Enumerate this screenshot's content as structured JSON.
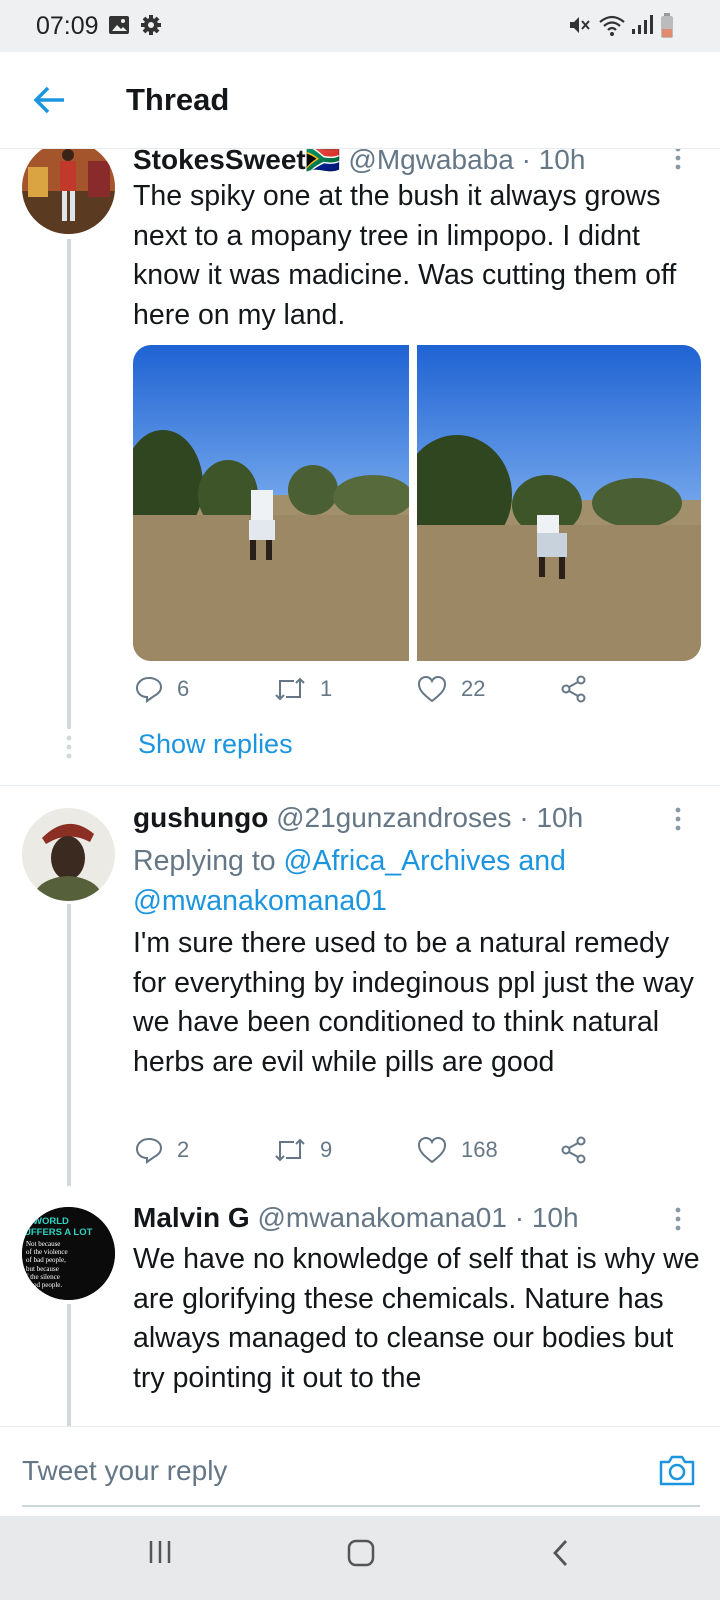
{
  "status_bar": {
    "time": "07:09"
  },
  "header": {
    "title": "Thread"
  },
  "tweets": [
    {
      "name": "StokesSweet🇿🇦",
      "handle": "@Mgwababa",
      "time": "· 10h",
      "text": "The spiky one at the bush it always grows next to a mopany tree in limpopo. I didnt know it was madicine. Was cutting them off here on my land.",
      "replies": "6",
      "retweets": "1",
      "likes": "22",
      "show_replies": "Show replies"
    },
    {
      "name": "gushungo",
      "handle": "@21gunzandroses",
      "time": "· 10h",
      "replying_prefix": "Replying to ",
      "replying_to_1": "@Africa_Archives",
      "replying_and": " and",
      "replying_to_2": "@mwanakomana01",
      "text": "I'm sure there used to be a natural remedy for everything by indeginous ppl just the way we have been conditioned to think natural herbs are evil while pills are good",
      "replies": "2",
      "retweets": "9",
      "likes": "168"
    },
    {
      "name": "Malvin G",
      "handle": "@mwanakomana01",
      "time": "· 10h",
      "text": "We have no knowledge of self that is why we are glorifying these chemicals. Nature has always managed to cleanse our bodies but try pointing it out to the",
      "avatar_text": [
        "E WORLD",
        "UFFERS A LOT",
        "Not because",
        "of the violence",
        "of bad people,",
        "but because",
        "f the silence",
        "good people."
      ]
    }
  ],
  "composer": {
    "placeholder": "Tweet your reply"
  },
  "colors": {
    "accent": "#1b95e0",
    "secondary_text": "#657786",
    "line": "#cfd9de"
  },
  "icons": [
    "back-arrow-icon",
    "reply-icon",
    "retweet-icon",
    "like-icon",
    "share-icon",
    "more-icon",
    "camera-icon",
    "image-icon",
    "settings-icon",
    "mute-icon",
    "wifi-icon",
    "signal-icon",
    "battery-icon",
    "recents-icon",
    "home-icon",
    "nav-back-icon"
  ]
}
